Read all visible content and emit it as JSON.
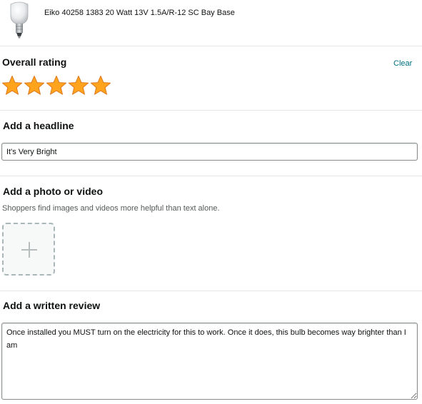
{
  "product": {
    "title": "Eiko 40258 1383 20 Watt 13V 1.5A/R-12 SC Bay Base",
    "image_icon": "light-bulb-icon"
  },
  "rating": {
    "title": "Overall rating",
    "clear_label": "Clear",
    "stars_filled": 5,
    "stars_total": 5,
    "star_color": "#ffa41c",
    "star_outline": "#de7921"
  },
  "headline": {
    "title": "Add a headline",
    "value": "It's Very Bright"
  },
  "media": {
    "title": "Add a photo or video",
    "helper": "Shoppers find images and videos more helpful than text alone.",
    "upload_icon": "plus-icon"
  },
  "review": {
    "title": "Add a written review",
    "value": "Once installed you MUST turn on the electricity for this to work. Once it does, this bulb becomes way brighter than I am"
  },
  "colors": {
    "link": "#007185",
    "border": "#888c8c",
    "divider": "#e3e6e6"
  }
}
